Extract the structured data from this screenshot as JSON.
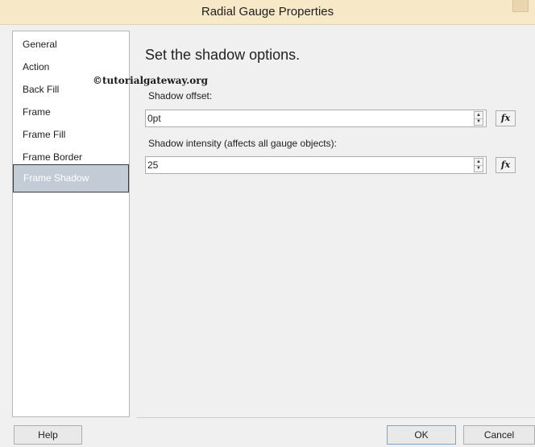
{
  "window": {
    "title": "Radial Gauge Properties"
  },
  "sidebar": {
    "items": [
      {
        "label": "General",
        "selected": false
      },
      {
        "label": "Action",
        "selected": false
      },
      {
        "label": "Back Fill",
        "selected": false
      },
      {
        "label": "Frame",
        "selected": false
      },
      {
        "label": "Frame Fill",
        "selected": false
      },
      {
        "label": "Frame Border",
        "selected": false
      },
      {
        "label": "Frame Shadow",
        "selected": true
      }
    ]
  },
  "main": {
    "heading": "Set the shadow options.",
    "watermark": "©tutorialgateway.org",
    "shadow_offset": {
      "label": "Shadow offset:",
      "value": "0pt"
    },
    "shadow_intensity": {
      "label": "Shadow intensity (affects all gauge objects):",
      "value": "25"
    },
    "expression_button": "fx"
  },
  "footer": {
    "help_label": "Help",
    "ok_label": "OK",
    "cancel_label": "Cancel"
  },
  "colors": {
    "titlebar": "#f7e8c8",
    "selected_item": "#c3cbd6",
    "dialog_background": "#f0f0f0"
  }
}
